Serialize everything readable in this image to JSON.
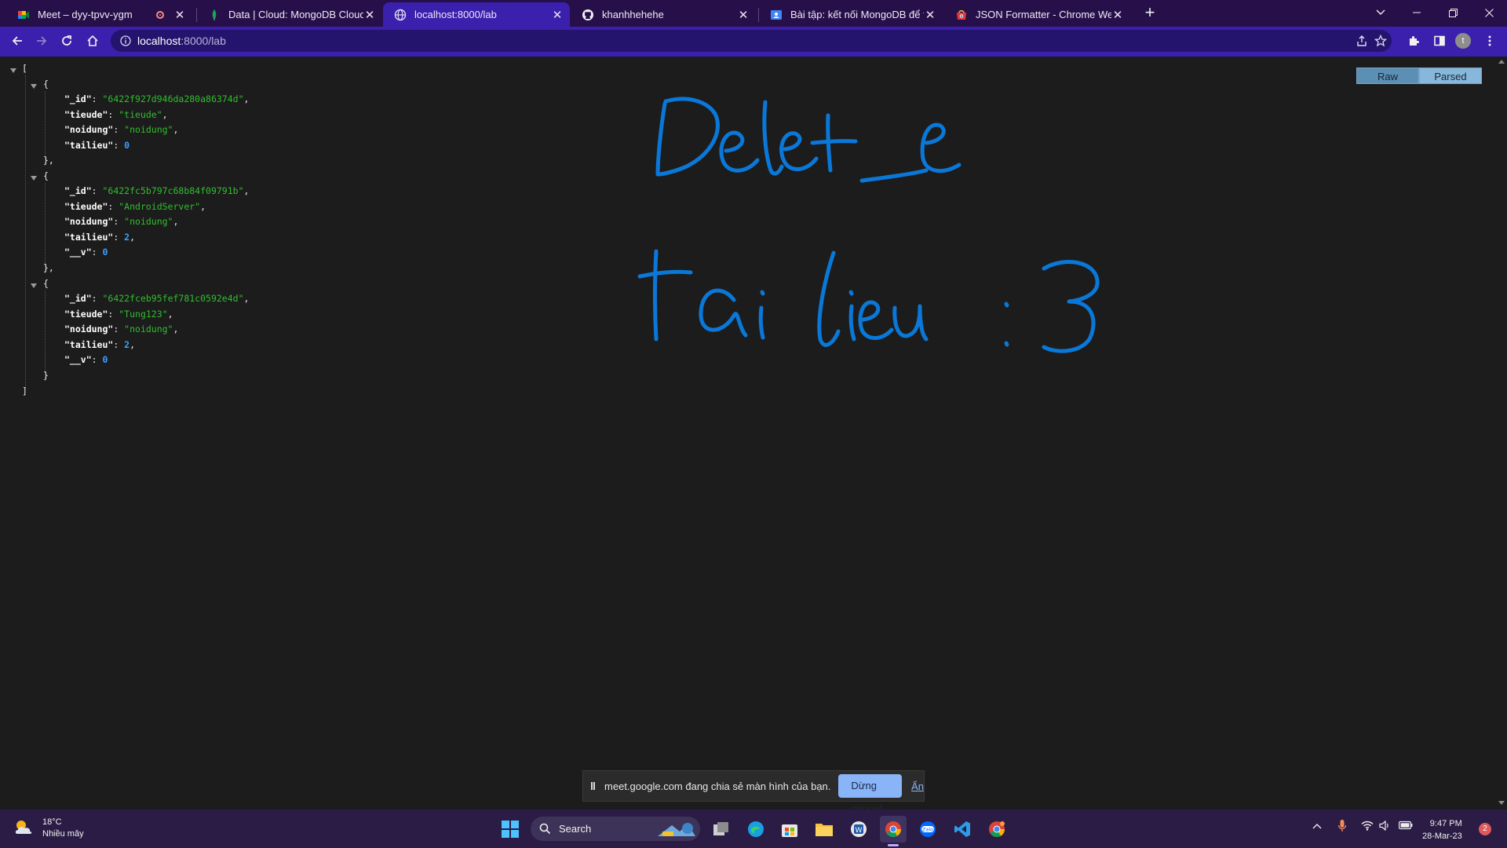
{
  "tabs": [
    {
      "title": "Meet – dyy-tpvv-ygm",
      "recording": true
    },
    {
      "title": "Data | Cloud: MongoDB Cloud"
    },
    {
      "title": "localhost:8000/lab"
    },
    {
      "title": "khanhhehehe"
    },
    {
      "title": "Bài tập: kết nối MongoDB để thể"
    },
    {
      "title": "JSON Formatter - Chrome Web S"
    }
  ],
  "active_tab_index": 2,
  "toolbar": {
    "url_host": "localhost",
    "url_path": ":8000/lab",
    "avatar_letter": "t"
  },
  "json_view": {
    "records": [
      {
        "_id": "\"6422f927d946da280a86374d\"",
        "tieude": "\"tieude\"",
        "noidung": "\"noidung\"",
        "tailieu": "0"
      },
      {
        "_id": "\"6422fc5b797c68b84f09791b\"",
        "tieude": "\"AndroidServer\"",
        "noidung": "\"noidung\"",
        "tailieu": "2",
        "__v": "0"
      },
      {
        "_id": "\"6422fceb95fef781c0592e4d\"",
        "tieude": "\"Tung123\"",
        "noidung": "\"noidung\"",
        "tailieu": "2",
        "__v": "0"
      }
    ],
    "keys": {
      "id": "\"_id\"",
      "tieude": "\"tieude\"",
      "noidung": "\"noidung\"",
      "tailieu": "\"tailieu\"",
      "v": "\"__v\""
    },
    "raw_label": "Raw",
    "parsed_label": "Parsed"
  },
  "handwriting": {
    "line1": "Delete",
    "line2": "tai lieu : 3",
    "color": "#0a78d8"
  },
  "share_banner": {
    "message": "meet.google.com đang chia sẻ màn hình của bạn.",
    "stop_label": "Dừng chia sẻ",
    "hide_label": "Ẩn"
  },
  "taskbar": {
    "temperature": "18°C",
    "weather": "Nhiều mây",
    "search_label": "Search",
    "time": "9:47 PM",
    "date": "28-Mar-23",
    "notifications": "2",
    "zalo_label": "Zalo"
  }
}
